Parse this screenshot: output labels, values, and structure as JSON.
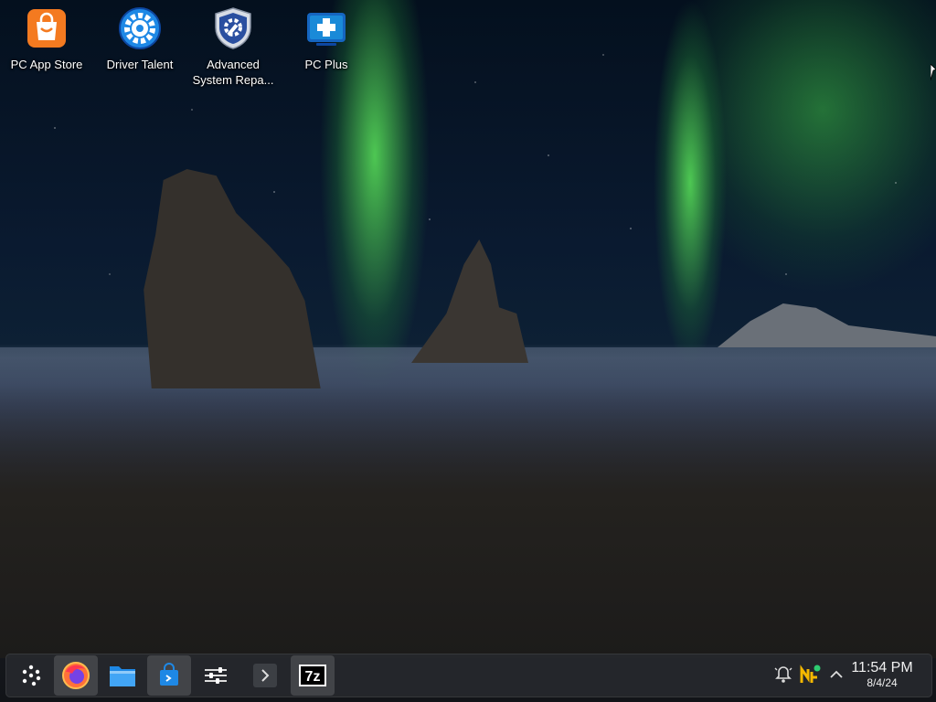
{
  "desktop": {
    "icons": [
      {
        "label": "PC App Store",
        "icon": "shopping-bag-icon",
        "color": "#f47a20"
      },
      {
        "label": "Driver Talent",
        "icon": "gear-icon",
        "color": "#1e88e5"
      },
      {
        "label": "Advanced System Repa...",
        "icon": "shield-gear-icon",
        "color": "#2a4fa0"
      },
      {
        "label": "PC Plus",
        "icon": "medical-cross-icon",
        "color": "#1a8ad8"
      }
    ]
  },
  "taskbar": {
    "launchers": [
      {
        "name": "app-launcher",
        "icon": "launcher-dots-icon"
      },
      {
        "name": "firefox",
        "icon": "firefox-icon",
        "active": true
      },
      {
        "name": "file-manager",
        "icon": "folder-icon"
      },
      {
        "name": "discover",
        "icon": "store-bag-icon",
        "active": true
      },
      {
        "name": "system-settings",
        "icon": "sliders-icon"
      },
      {
        "name": "terminal",
        "icon": "terminal-icon"
      },
      {
        "name": "7zip",
        "icon": "seven-zip-icon",
        "text": "7z",
        "active": true
      }
    ],
    "tray": [
      {
        "name": "notifications",
        "icon": "bell-icon"
      },
      {
        "name": "updates",
        "icon": "update-notifier-icon"
      },
      {
        "name": "expand",
        "icon": "chevron-up-icon"
      }
    ],
    "clock": {
      "time": "11:54 PM",
      "date": "8/4/24"
    }
  }
}
